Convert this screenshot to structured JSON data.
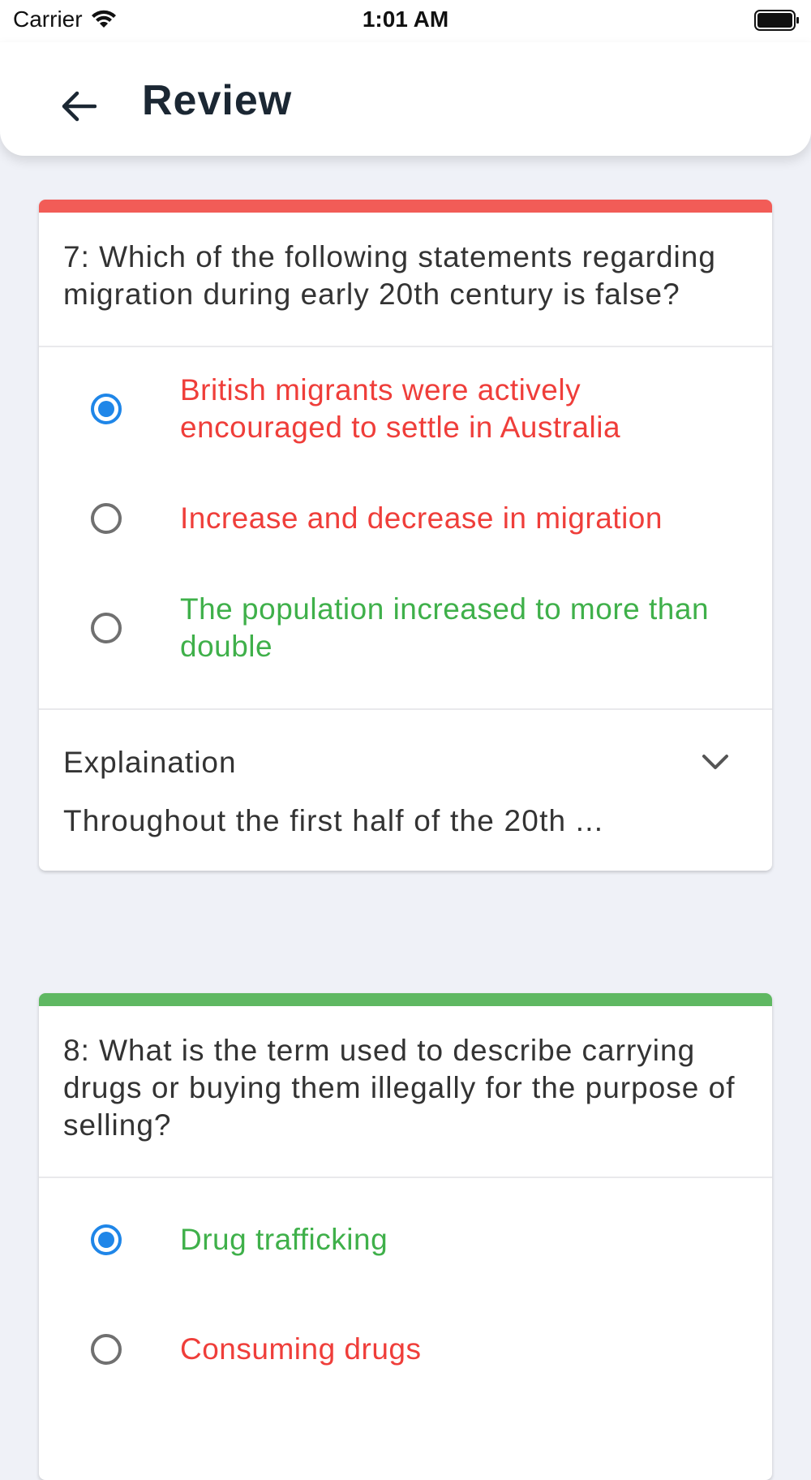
{
  "status": {
    "carrier": "Carrier",
    "time": "1:01 AM"
  },
  "header": {
    "title": "Review"
  },
  "colors": {
    "wrong": "#ef3e3a",
    "correct": "#3fb04a",
    "selected": "#1f86e8",
    "bar_wrong": "#f25c57",
    "bar_correct": "#5fb862"
  },
  "questions": [
    {
      "text": "7: Which of the following statements regarding migration during early 20th century is false?",
      "options": [
        {
          "label": "British migrants were actively encouraged to settle in Australia",
          "selected": true,
          "status": "wrong"
        },
        {
          "label": "Increase and decrease in migration",
          "selected": false,
          "status": "wrong"
        },
        {
          "label": "The population increased to more than double",
          "selected": false,
          "status": "correct"
        }
      ],
      "explanation_title": "Explaination",
      "explanation_preview": "Throughout the first half of the 20th ..."
    },
    {
      "text": "8: What is the term used to describe carrying drugs or buying them illegally for the purpose of selling?",
      "options": [
        {
          "label": "Drug trafficking",
          "selected": true,
          "status": "correct"
        },
        {
          "label": "Consuming drugs",
          "selected": false,
          "status": "wrong"
        }
      ]
    }
  ]
}
